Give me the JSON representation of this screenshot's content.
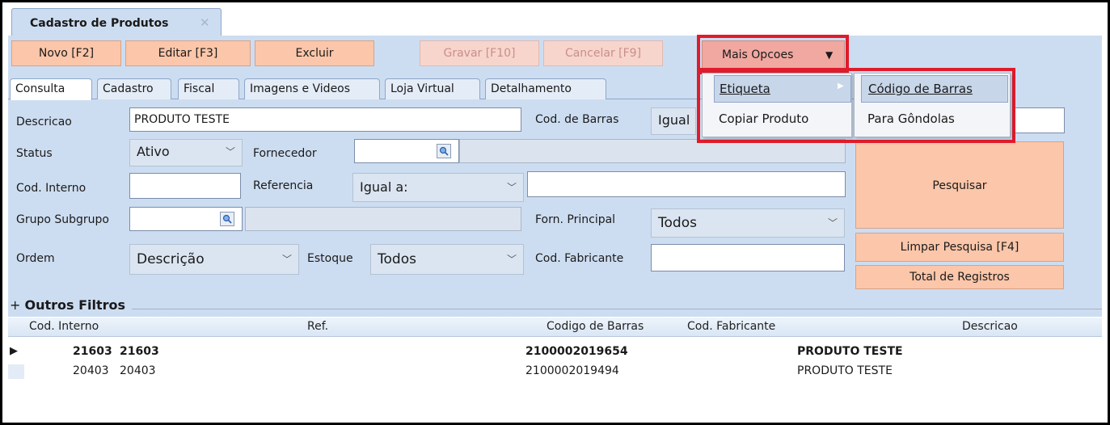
{
  "window": {
    "tab_title": "Cadastro de Produtos",
    "tab_close": "✕"
  },
  "toolbar": {
    "novo": "Novo [F2]",
    "editar": "Editar [F3]",
    "excluir": "Excluir",
    "gravar": "Gravar [F10]",
    "cancelar": "Cancelar [F9]",
    "mais_opcoes": "Mais Opcoes"
  },
  "tabs": [
    "Consulta",
    "Cadastro",
    "Fiscal",
    "Imagens e Videos",
    "Loja Virtual",
    "Detalhamento"
  ],
  "form": {
    "descricao_label": "Descricao",
    "descricao_value": "PRODUTO TESTE",
    "cod_barras_label": "Cod. de Barras",
    "cod_barras_select": "Igual",
    "status_label": "Status",
    "status_value": "Ativo",
    "fornecedor_label": "Fornecedor",
    "cod_interno_label": "Cod. Interno",
    "referencia_label": "Referencia",
    "referencia_select": "Igual a:",
    "grupo_label": "Grupo Subgrupo",
    "forn_principal_label": "Forn. Principal",
    "forn_principal_value": "Todos",
    "ordem_label": "Ordem",
    "ordem_value": "Descrição",
    "estoque_label": "Estoque",
    "estoque_value": "Todos",
    "cod_fabricante_label": "Cod. Fabricante"
  },
  "actions": {
    "pesquisar": "Pesquisar",
    "limpar": "Limpar Pesquisa [F4]",
    "total": "Total de Registros"
  },
  "outros_filtros": "Outros Filtros",
  "outros_filtros_sign": "+",
  "menu": {
    "etiqueta": "Etiqueta",
    "copiar": "Copiar Produto",
    "codigo_barras": "Código de Barras",
    "para_gondolas": "Para Gôndolas"
  },
  "grid": {
    "headers": [
      "Cod. Interno",
      "Ref.",
      "Codigo de Barras",
      "Cod. Fabricante",
      "Descricao"
    ],
    "rows": [
      {
        "cod": "21603",
        "ref": "21603",
        "barras": "2100002019654",
        "fab": "",
        "desc": "PRODUTO TESTE"
      },
      {
        "cod": "20403",
        "ref": "20403",
        "barras": "2100002019494",
        "fab": "",
        "desc": "PRODUTO TESTE"
      }
    ]
  },
  "colors": {
    "accent_button": "#fbc6a9",
    "panel": "#cdddf1",
    "highlight_box": "#e01b2b"
  }
}
